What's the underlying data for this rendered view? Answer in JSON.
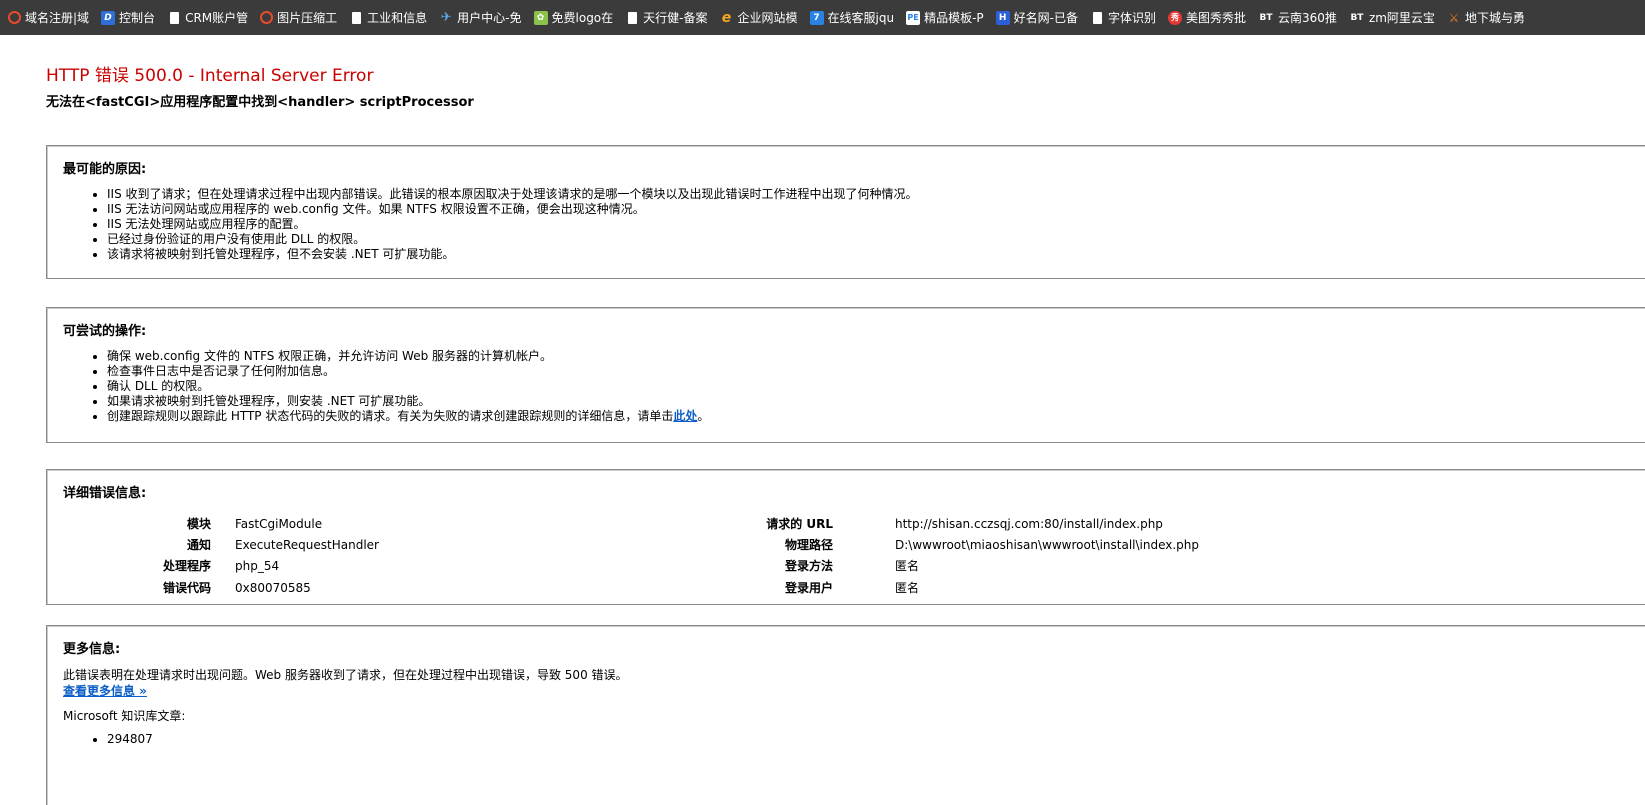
{
  "bookmarks": [
    {
      "label": "域名注册|域",
      "icon": "red-ring-icon"
    },
    {
      "label": "控制台",
      "icon": "d-logo-icon"
    },
    {
      "label": "CRM账户管",
      "icon": "page-icon"
    },
    {
      "label": "图片压缩工",
      "icon": "red-ring-icon"
    },
    {
      "label": "工业和信息",
      "icon": "page-icon"
    },
    {
      "label": "用户中心-免",
      "icon": "bird-icon"
    },
    {
      "label": "免费logo在",
      "icon": "green-leaf-icon"
    },
    {
      "label": "天行健-备案",
      "icon": "page-icon"
    },
    {
      "label": "企业网站模",
      "icon": "e-logo-icon"
    },
    {
      "label": "在线客服jqu",
      "icon": "seven-logo-icon"
    },
    {
      "label": "精品模板-P",
      "icon": "pe-logo-icon"
    },
    {
      "label": "好名网-已备",
      "icon": "h-logo-icon"
    },
    {
      "label": "字体识别",
      "icon": "page-icon"
    },
    {
      "label": "美图秀秀批",
      "icon": "meitu-icon"
    },
    {
      "label": "云南360推",
      "icon": "bt-icon"
    },
    {
      "label": "zm阿里云宝",
      "icon": "bt-icon"
    },
    {
      "label": "地下城与勇",
      "icon": "game-icon"
    }
  ],
  "page": {
    "title": "HTTP 错误 500.0 - Internal Server Error",
    "subtitle": "无法在<fastCGI>应用程序配置中找到<handler> scriptProcessor"
  },
  "causes": {
    "heading": "最可能的原因:",
    "items": [
      "IIS 收到了请求；但在处理请求过程中出现内部错误。此错误的根本原因取决于处理该请求的是哪一个模块以及出现此错误时工作进程中出现了何种情况。",
      "IIS 无法访问网站或应用程序的 web.config 文件。如果 NTFS 权限设置不正确，便会出现这种情况。",
      "IIS 无法处理网站或应用程序的配置。",
      "已经过身份验证的用户没有使用此 DLL 的权限。",
      "该请求将被映射到托管处理程序，但不会安装 .NET 可扩展功能。"
    ]
  },
  "actions": {
    "heading": "可尝试的操作:",
    "items": [
      "确保 web.config 文件的 NTFS 权限正确，并允许访问 Web 服务器的计算机帐户。",
      "检查事件日志中是否记录了任何附加信息。",
      "确认 DLL 的权限。",
      "如果请求被映射到托管处理程序，则安装 .NET 可扩展功能。"
    ],
    "last_item_text": "创建跟踪规则以跟踪此 HTTP 状态代码的失败的请求。有关为失败的请求创建跟踪规则的详细信息，请单击",
    "last_item_link": "此处",
    "last_item_end": "。"
  },
  "details": {
    "heading": "详细错误信息:",
    "left": [
      {
        "label": "模块",
        "value": "FastCgiModule"
      },
      {
        "label": "通知",
        "value": "ExecuteRequestHandler"
      },
      {
        "label": "处理程序",
        "value": "php_54"
      },
      {
        "label": "错误代码",
        "value": "0x80070585"
      }
    ],
    "right": [
      {
        "label": "请求的 URL",
        "value": "http://shisan.cczsqj.com:80/install/index.php"
      },
      {
        "label": "物理路径",
        "value": "D:\\wwwroot\\miaoshisan\\wwwroot\\install\\index.php"
      },
      {
        "label": "登录方法",
        "value": "匿名"
      },
      {
        "label": "登录用户",
        "value": "匿名"
      }
    ]
  },
  "more": {
    "heading": "更多信息:",
    "text": "此错误表明在处理请求时出现问题。Web 服务器收到了请求，但在处理过程中出现错误，导致 500 错误。",
    "link": "查看更多信息 »",
    "kb_label": "Microsoft 知识库文章:",
    "kb_items": [
      "294807"
    ]
  },
  "colors": {
    "title_red": "#cc0000",
    "link_blue": "#0b5dc7",
    "bookmark_bar": "#3b3b3b"
  }
}
